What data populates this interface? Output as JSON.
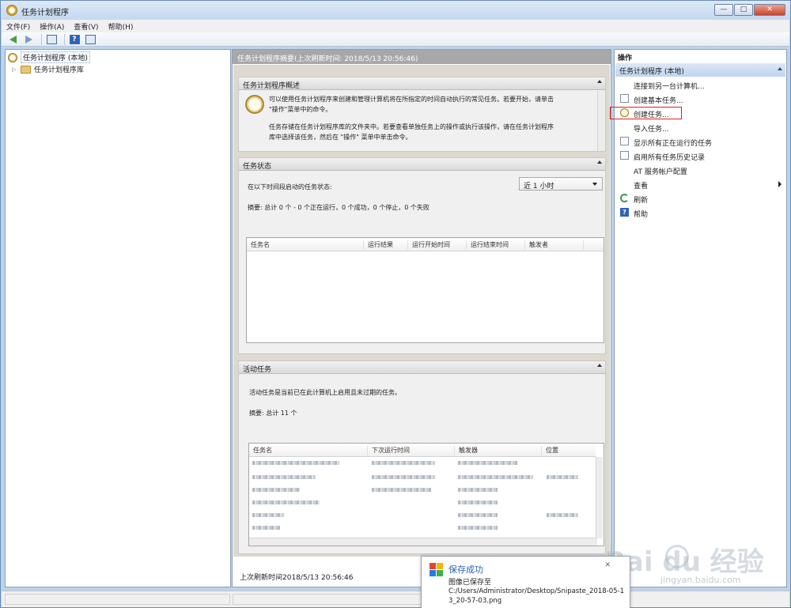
{
  "window": {
    "title": "任务计划程序",
    "buttons": {
      "minimize": "—",
      "maximize": "□",
      "close": "✕"
    }
  },
  "menu": [
    "文件(F)",
    "操作(A)",
    "查看(V)",
    "帮助(H)"
  ],
  "tree": {
    "root": "任务计划程序 (本地)",
    "child": "任务计划程序库"
  },
  "middle": {
    "header": "任务计划程序摘要(上次刷新时间: 2018/5/13 20:56:46)",
    "overview": {
      "title": "任务计划程序概述",
      "para1_line1": "可以使用任务计划程序来创建和管理计算机将在所指定的时间自动执行的常见任务。若要开始，请单击",
      "para1_line2": "\"操作\"菜单中的命令。",
      "para2_line1": "任务存储在任务计划程序库的文件夹中。若要查看单独任务上的操作或执行该操作，请在任务计划程序",
      "para2_line2": "库中选择该任务，然后在 \"操作\" 菜单中单击命令。"
    },
    "status": {
      "title": "任务状态",
      "label": "在以下时间段启动的任务状态:",
      "period": "近 1 小时",
      "summary": "摘要: 总计 0 个 - 0 个正在运行，0 个成功，0 个停止，0 个失败",
      "columns": [
        "任务名",
        "运行结果",
        "运行开始时间",
        "运行结束时间",
        "触发者"
      ]
    },
    "active": {
      "title": "活动任务",
      "desc": "活动任务是当前已在此计算机上启用且未过期的任务。",
      "summary": "摘要: 总计 11 个",
      "columns": [
        "任务名",
        "下次运行时间",
        "触发器",
        "位置"
      ]
    },
    "last_refresh": "上次刷新时间2018/5/13 20:56:46"
  },
  "actions": {
    "title": "操作",
    "group": "任务计划程序 (本地)",
    "items": [
      {
        "label": "连接到另一台计算机...",
        "icon": "none"
      },
      {
        "label": "创建基本任务...",
        "icon": "page-icon"
      },
      {
        "label": "创建任务...",
        "icon": "clock-icon"
      },
      {
        "label": "导入任务...",
        "icon": "none"
      },
      {
        "label": "显示所有正在运行的任务",
        "icon": "page-icon"
      },
      {
        "label": "启用所有任务历史记录",
        "icon": "page-icon"
      },
      {
        "label": "AT 服务帐户配置",
        "icon": "none"
      },
      {
        "label": "查看",
        "icon": "none"
      },
      {
        "label": "刷新",
        "icon": "refresh-icon"
      },
      {
        "label": "帮助",
        "icon": "help-icon"
      }
    ],
    "highlight_color": "#e02020"
  },
  "toast": {
    "title": "保存成功",
    "subtitle": "图像已保存至",
    "path": "C:/Users/Administrator/Desktop/Snipaste_2018-05-13_20-57-03.png",
    "close": "✕"
  },
  "watermark": {
    "main": "Bai du 经验",
    "sub": "jingyan.baidu.com"
  },
  "colors": {
    "titlebar": "#c4d8ef",
    "accent": "#2a62b7",
    "panel_bg": "#ddd9d0"
  }
}
